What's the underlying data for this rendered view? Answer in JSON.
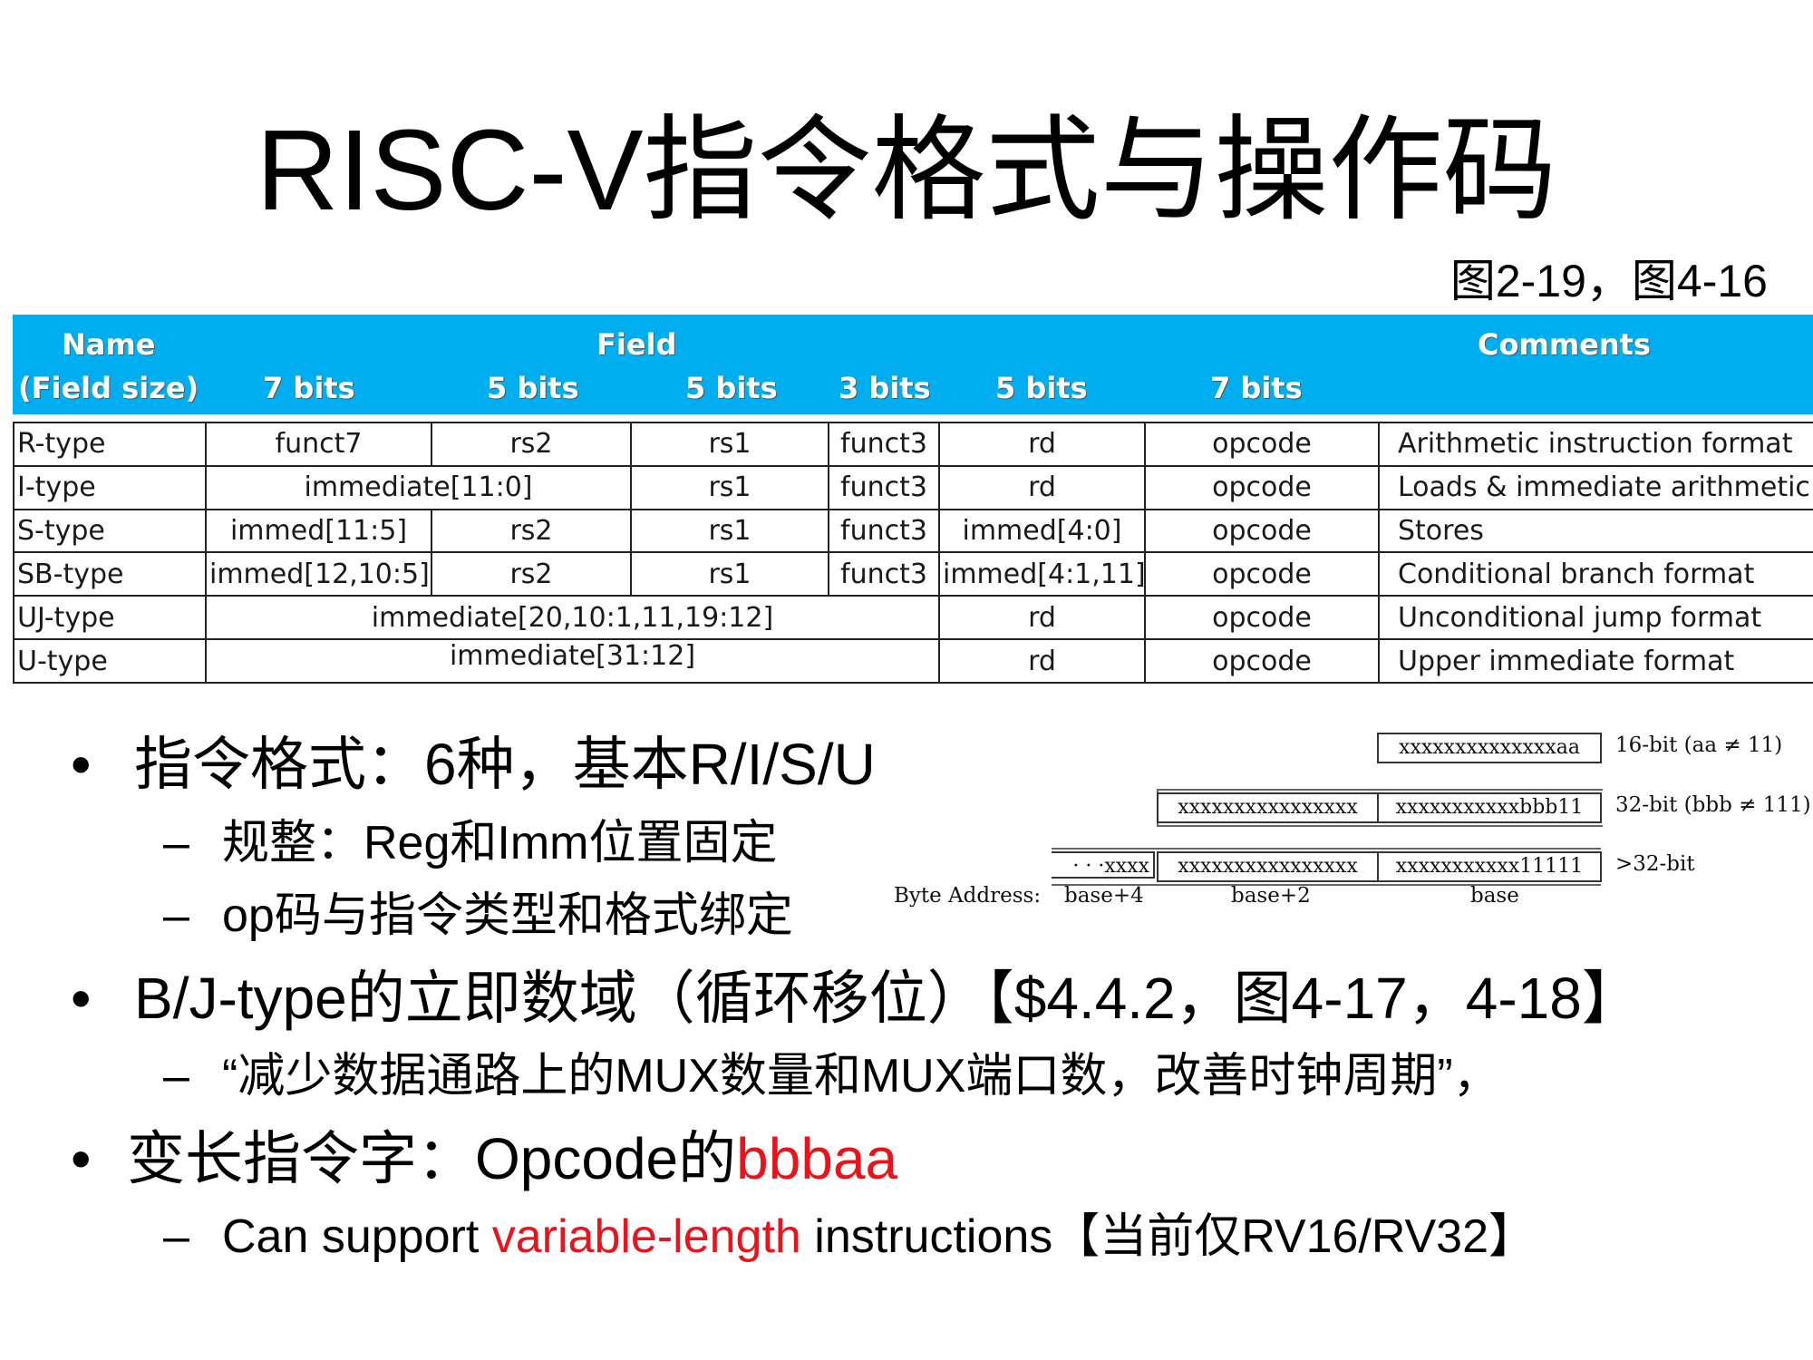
{
  "title": "RISC-V指令格式与操作码",
  "figref": "图2-19，图4-16",
  "table": {
    "header": {
      "name_line1": "Name",
      "name_line2": "(Field size)",
      "field": "Field",
      "comments": "Comments",
      "sizes": [
        "7 bits",
        "5 bits",
        "5 bits",
        "3 bits",
        "5 bits",
        "7 bits"
      ]
    },
    "rows": [
      {
        "name": "R-type",
        "f1": "funct7",
        "f2": "rs2",
        "f3": "rs1",
        "f4": "funct3",
        "f5": "rd",
        "f6": "opcode",
        "comment": "Arithmetic instruction format"
      },
      {
        "name": "I-type",
        "f12": "immediate[11:0]",
        "f3": "rs1",
        "f4": "funct3",
        "f5": "rd",
        "f6": "opcode",
        "comment": "Loads & immediate arithmetic"
      },
      {
        "name": "S-type",
        "f1": "immed[11:5]",
        "f2": "rs2",
        "f3": "rs1",
        "f4": "funct3",
        "f5": "immed[4:0]",
        "f6": "opcode",
        "comment": "Stores"
      },
      {
        "name": "SB-type",
        "f1": "immed[12,10:5]",
        "f2": "rs2",
        "f3": "rs1",
        "f4": "funct3",
        "f5": "immed[4:1,11]",
        "f6": "opcode",
        "comment": "Conditional branch format"
      },
      {
        "name": "UJ-type",
        "f1234": "immediate[20,10:1,11,19:12]",
        "f5": "rd",
        "f6": "opcode",
        "comment": "Unconditional jump format"
      },
      {
        "name": "U-type",
        "f1234": "immediate[31:12]",
        "f5": "rd",
        "f6": "opcode",
        "comment": "Upper immediate format"
      }
    ]
  },
  "bullets": {
    "b1": "指令格式：6种，基本R/I/S/U",
    "b1_sub1": "规整：Reg和Imm位置固定",
    "b1_sub2": "op码与指令类型和格式绑定",
    "b2": "B/J-type的立即数域（循环移位）【$4.4.2，图4-17，4-18】",
    "b2_sub1": "“减少数据通路上的MUX数量和MUX端口数，改善时钟周期”，",
    "b3_prefix": "变长指令字：Opcode的",
    "b3_red": "bbbaa",
    "b3_sub1_prefix": "Can support ",
    "b3_sub1_red": "variable-length",
    "b3_sub1_suffix": " instructions【当前仅RV16/RV32】",
    "bullet_char": "•",
    "dash_char": "–"
  },
  "varlen": {
    "rows": [
      {
        "boxes": [
          "xxxxxxxxxxxxxxaa"
        ],
        "label": "16-bit (aa ≠ 11)"
      },
      {
        "boxes": [
          "xxxxxxxxxxxxxxxx",
          "xxxxxxxxxxxbbb11"
        ],
        "label": "32-bit (bbb ≠ 111)"
      },
      {
        "boxes": [
          "· · ·xxxx",
          "xxxxxxxxxxxxxxxx",
          "xxxxxxxxxxx11111"
        ],
        "label": ">32-bit"
      }
    ],
    "byte_address_label": "Byte Address:",
    "addresses": [
      "base+4",
      "base+2",
      "base"
    ]
  }
}
